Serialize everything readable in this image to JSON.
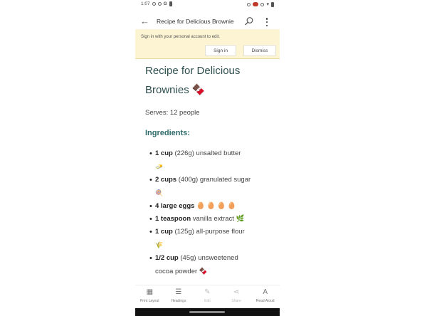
{
  "status_bar": {
    "time": "1:07",
    "left_icons": [
      "circle-icon",
      "circle-icon",
      "google-icon",
      "battery-icon"
    ],
    "right_icons": [
      "circle-icon",
      "record-icon",
      "circle-icon",
      "wifi-icon",
      "battery-icon"
    ],
    "g_label": "G"
  },
  "app_bar": {
    "back_icon": "←",
    "title": "Recipe for Delicious Brownie"
  },
  "banner": {
    "text": "Sign in with your personal account to edit.",
    "signin_label": "Sign in",
    "dismiss_label": "Dismiss"
  },
  "document": {
    "title_line1": "Recipe for Delicious",
    "title_line2": "Brownies 🍫",
    "serves": "Serves: 12 people",
    "ingredients_heading": "Ingredients:",
    "items": [
      {
        "qty": "1 cup",
        "rest": " (226g) unsalted butter",
        "emoji": "🧈"
      },
      {
        "qty": "2 cups",
        "rest": " (400g) granulated sugar",
        "emoji": "🍭"
      },
      {
        "qty": "4 large eggs",
        "rest": " 🥚 🥚 🥚 🥚",
        "emoji": ""
      },
      {
        "qty": "1 teaspoon",
        "rest": " vanilla extract 🌿",
        "emoji": ""
      },
      {
        "qty": "1 cup",
        "rest": " (125g) all-purpose flour",
        "emoji": "🌾"
      },
      {
        "qty": "1/2 cup",
        "rest": " (45g) unsweetened",
        "emoji": "cocoa powder 🍫"
      }
    ]
  },
  "bottom_nav": {
    "items": [
      {
        "label": "Print Layout",
        "icon": "▦"
      },
      {
        "label": "Headings",
        "icon": "☰"
      },
      {
        "label": "Edit",
        "icon": "✎"
      },
      {
        "label": "Share",
        "icon": "⋖"
      },
      {
        "label": "Read Aloud",
        "icon": "A"
      }
    ]
  },
  "colors": {
    "banner_bg": "#fdf4d4",
    "heading": "#2f4f4f",
    "section_heading": "#2f6b6b"
  }
}
